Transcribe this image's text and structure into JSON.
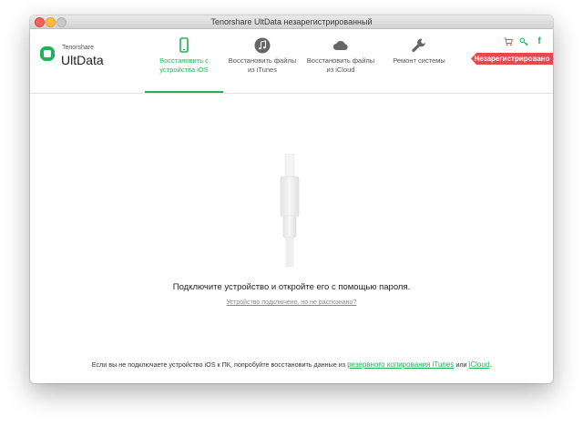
{
  "window": {
    "title": "Tenorshare UltData незарегистрированный"
  },
  "logo": {
    "brand": "Tenorshare",
    "product": "UltData"
  },
  "nav": {
    "tabs": [
      {
        "line1": "Восстановить с",
        "line2": "устройства iOS",
        "icon": "phone-icon",
        "active": true
      },
      {
        "line1": "Восстановить файлы",
        "line2": "из iTunes",
        "icon": "music-icon",
        "active": false
      },
      {
        "line1": "Восстановить файлы",
        "line2": "из iCloud",
        "icon": "cloud-icon",
        "active": false
      },
      {
        "line1": "Ремонт системы",
        "line2": "",
        "icon": "wrench-icon",
        "active": false
      }
    ]
  },
  "toolbar": {
    "icons": [
      "cart-icon",
      "key-icon",
      "facebook-icon"
    ],
    "facebook_glyph": "f",
    "register_badge": "Незарегистрировано"
  },
  "main": {
    "message": "Подключите устройство и откройте его с помощью пароля.",
    "link": "Устройство подключено, но не распознано?",
    "footer_prefix": "Если вы не подключаете устройство iOS к ПК, попробуйте восстановить данные из ",
    "footer_link1": "резервного копирования iTunes",
    "footer_mid": " или ",
    "footer_link2": "iCloud",
    "footer_suffix": "."
  },
  "colors": {
    "accent": "#1fb35a",
    "badge": "#e8484d",
    "icon_gray": "#666666"
  }
}
